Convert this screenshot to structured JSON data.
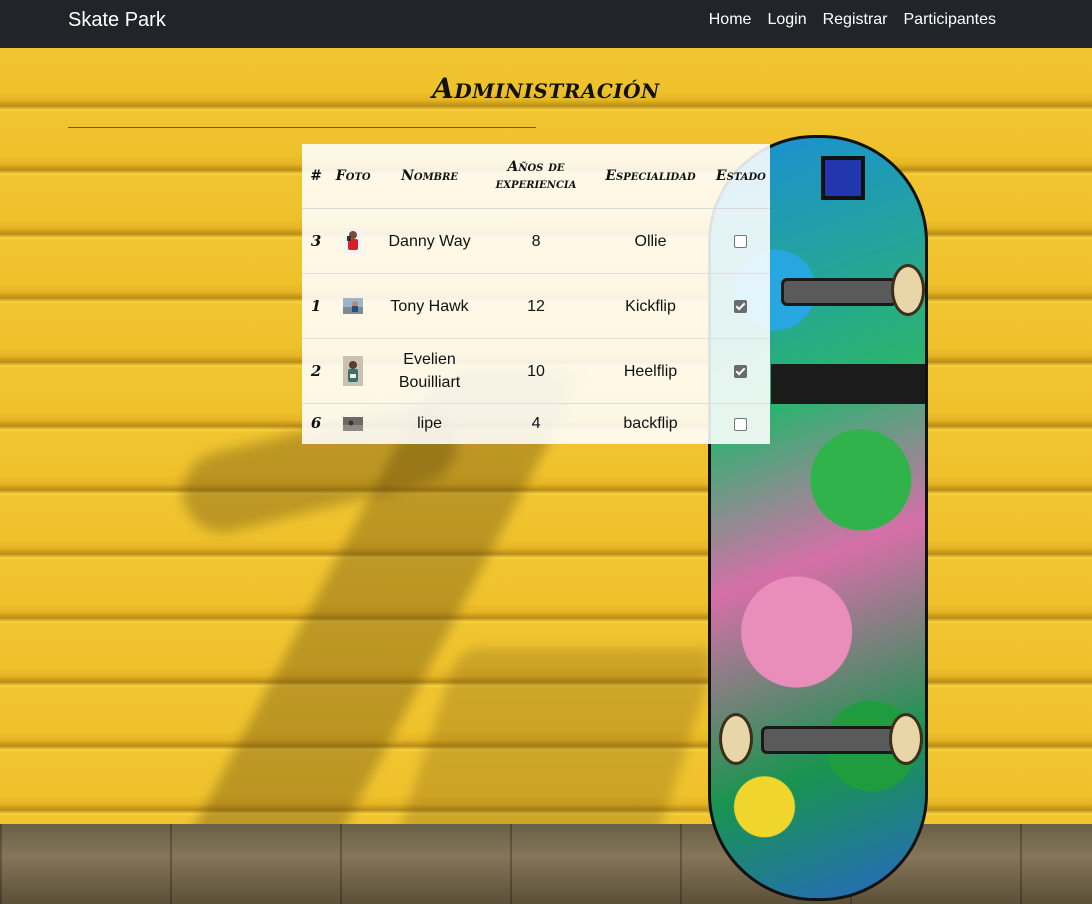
{
  "navbar": {
    "brand": "Skate Park",
    "links": [
      "Home",
      "Login",
      "Registrar",
      "Participantes"
    ]
  },
  "page": {
    "title": "Administración"
  },
  "table": {
    "headers": [
      "#",
      "Foto",
      "Nombre",
      "Años de experiencia",
      "Especialidad",
      "Estado"
    ],
    "rows": [
      {
        "id": "3",
        "photo": "photo-thumbnail",
        "name": "Danny Way",
        "years": "8",
        "specialty": "Ollie",
        "checked": false
      },
      {
        "id": "1",
        "photo": "photo-thumbnail",
        "name": "Tony Hawk",
        "years": "12",
        "specialty": "Kickflip",
        "checked": true
      },
      {
        "id": "2",
        "photo": "photo-thumbnail",
        "name": "Evelien Bouilliart",
        "years": "10",
        "specialty": "Heelflip",
        "checked": true
      },
      {
        "id": "6",
        "photo": "photo-thumbnail",
        "name": "lipe",
        "years": "4",
        "specialty": "backflip",
        "checked": false
      }
    ]
  },
  "colors": {
    "navbar_bg": "#212529",
    "wall_yellow": "#f0c530"
  }
}
